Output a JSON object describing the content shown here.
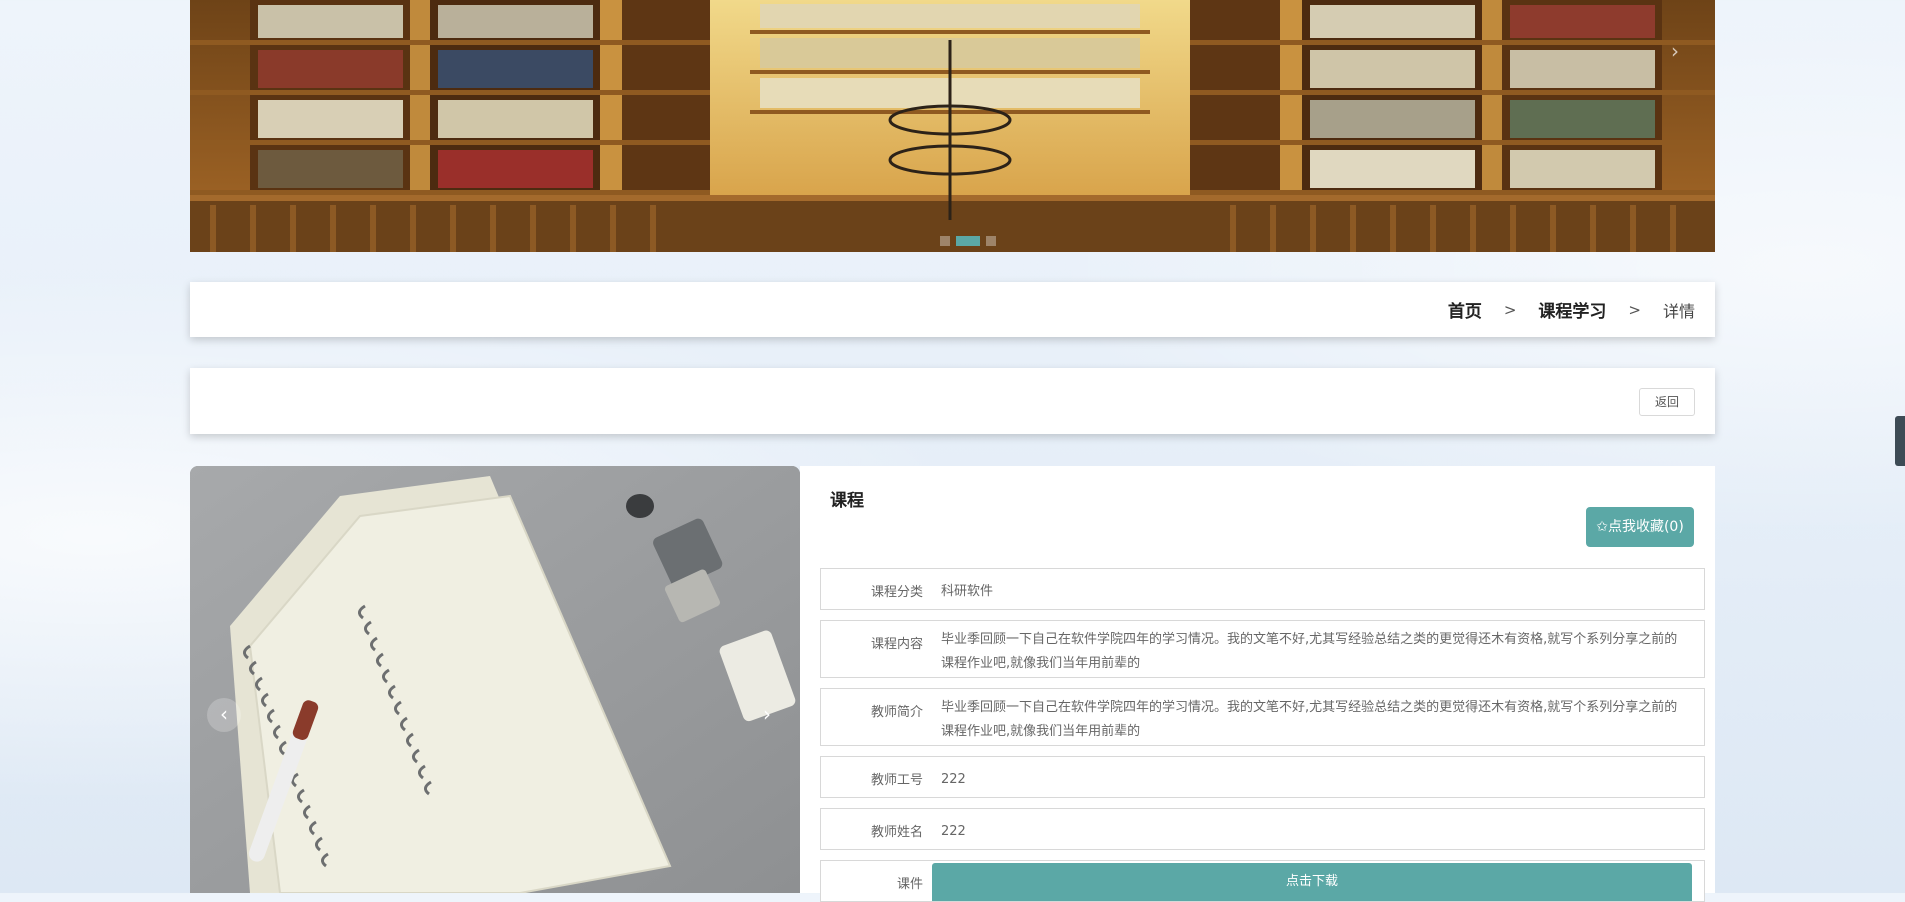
{
  "banner": {
    "next_arrow": "›",
    "dots": [
      {
        "active": true
      },
      {
        "active": false
      },
      {
        "active": false
      }
    ]
  },
  "breadcrumb": {
    "home": "首页",
    "separator": ">",
    "section": "课程学习",
    "current": "详情"
  },
  "actions": {
    "back_label": "返回"
  },
  "gallery": {
    "prev_arrow": "‹",
    "next_arrow": "›"
  },
  "detail": {
    "title": "课程",
    "favorite_label": "✩点我收藏(0)",
    "fields": [
      {
        "label": "课程分类",
        "value": "科研软件"
      },
      {
        "label": "课程内容",
        "value": "毕业季回顾一下自己在软件学院四年的学习情况。我的文笔不好,尤其写经验总结之类的更觉得还木有资格,就写个系列分享之前的课程作业吧,就像我们当年用前辈的"
      },
      {
        "label": "教师简介",
        "value": "毕业季回顾一下自己在软件学院四年的学习情况。我的文笔不好,尤其写经验总结之类的更觉得还木有资格,就写个系列分享之前的课程作业吧,就像我们当年用前辈的"
      },
      {
        "label": "教师工号",
        "value": "222"
      },
      {
        "label": "教师姓名",
        "value": "222"
      },
      {
        "label": "课件",
        "button": "点击下载"
      }
    ]
  },
  "colors": {
    "accent": "#5ba8a6",
    "card_bg": "#ffffff",
    "side_handle": "#3d4b55"
  }
}
